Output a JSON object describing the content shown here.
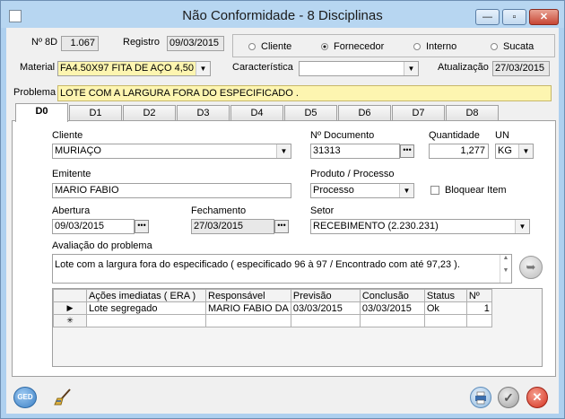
{
  "window": {
    "title": "Não Conformidade - 8 Disciplinas",
    "minimize_symbol": "—",
    "maximize_symbol": "▫",
    "close_symbol": "✕"
  },
  "header": {
    "n8d_label": "Nº 8D",
    "n8d_value": "1.067",
    "registro_label": "Registro",
    "registro_value": "09/03/2015",
    "radio_options": [
      {
        "label": "Cliente",
        "selected": false
      },
      {
        "label": "Fornecedor",
        "selected": true
      },
      {
        "label": "Interno",
        "selected": false
      },
      {
        "label": "Sucata",
        "selected": false
      }
    ],
    "material_label": "Material",
    "material_value": "FA4.50X97   FITA DE AÇO 4,50",
    "caracteristica_label": "Característica",
    "caracteristica_value": "",
    "atualizacao_label": "Atualização",
    "atualizacao_value": "27/03/2015",
    "problema_label": "Problema",
    "problema_value": "LOTE COM A LARGURA FORA DO ESPECIFICADO  ."
  },
  "tabs": [
    {
      "label": "D0",
      "active": true
    },
    {
      "label": "D1",
      "active": false
    },
    {
      "label": "D2",
      "active": false
    },
    {
      "label": "D3",
      "active": false
    },
    {
      "label": "D4",
      "active": false
    },
    {
      "label": "D5",
      "active": false
    },
    {
      "label": "D6",
      "active": false
    },
    {
      "label": "D7",
      "active": false
    },
    {
      "label": "D8",
      "active": false
    }
  ],
  "d0": {
    "cliente_label": "Cliente",
    "cliente_value": "MURIAÇO",
    "documento_label": "Nº Documento",
    "documento_value": "31313",
    "quantidade_label": "Quantidade",
    "quantidade_value": "1,277",
    "un_label": "UN",
    "un_value": "KG",
    "emitente_label": "Emitente",
    "emitente_value": "MARIO FABIO",
    "produto_label": "Produto / Processo",
    "produto_value": "Processo",
    "bloquear_label": "Bloquear Item",
    "bloquear_checked": false,
    "abertura_label": "Abertura",
    "abertura_value": "09/03/2015",
    "fechamento_label": "Fechamento",
    "fechamento_value": "27/03/2015",
    "setor_label": "Setor",
    "setor_value": "RECEBIMENTO (2.230.231)",
    "avaliacao_label": "Avaliação do problema",
    "avaliacao_value": "Lote com a largura fora do especificado ( especificado 96 à 97 / Encontrado com até 97,23 ).",
    "date_button_symbol": "•••"
  },
  "actions_table": {
    "columns": [
      "Ações imediatas ( ERA )",
      "Responsável",
      "Previsão",
      "Conclusão",
      "Status",
      "Nº"
    ],
    "rows": [
      [
        "Lote segregado",
        "MARIO FABIO DA",
        "03/03/2015",
        "03/03/2015",
        "Ok",
        "1"
      ]
    ],
    "current_row_symbol": "▶",
    "new_row_symbol": "✳"
  },
  "footer": {
    "ged_label": "GED"
  },
  "icons": {
    "ged": "ged-icon",
    "broom": "broom-icon",
    "print": "print-icon",
    "confirm": "check-icon",
    "cancel": "cancel-icon",
    "send": "send-icon"
  },
  "colors": {
    "title_bar": "#b7d6f1",
    "problem_bg": "#fdf5b0",
    "cancel_red": "#d42f1e"
  }
}
